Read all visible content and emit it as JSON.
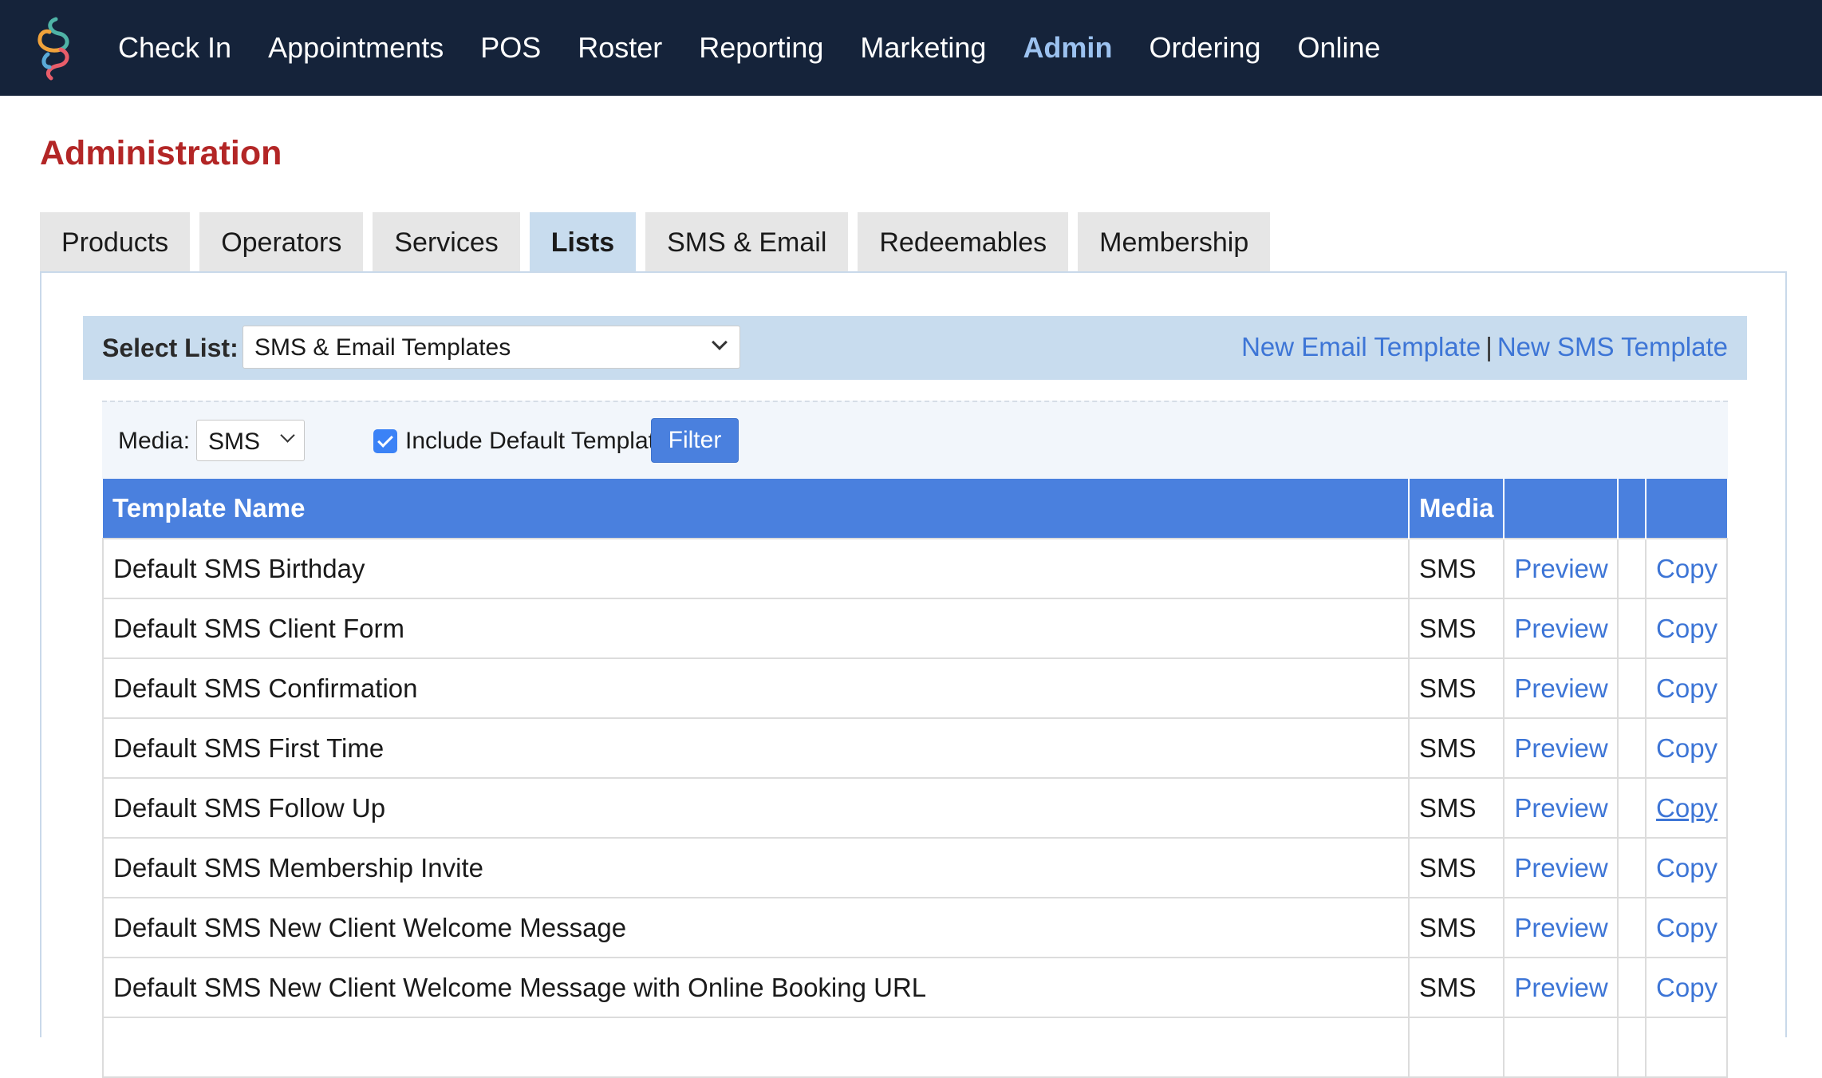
{
  "nav": {
    "items": [
      "Check In",
      "Appointments",
      "POS",
      "Roster",
      "Reporting",
      "Marketing",
      "Admin",
      "Ordering",
      "Online"
    ],
    "active": "Admin"
  },
  "page_title": "Administration",
  "tabs": {
    "items": [
      "Products",
      "Operators",
      "Services",
      "Lists",
      "SMS & Email",
      "Redeemables",
      "Membership"
    ],
    "active": "Lists"
  },
  "select_list": {
    "label": "Select List:",
    "value": "SMS & Email Templates"
  },
  "links": {
    "new_email": "New Email Template",
    "separator": "|",
    "new_sms": "New SMS Template"
  },
  "filter": {
    "media_label": "Media:",
    "media_value": "SMS",
    "include_default_label": "Include Default Templates",
    "include_default_checked": true,
    "button_label": "Filter"
  },
  "table": {
    "headers": [
      "Template Name",
      "Media",
      "",
      "",
      ""
    ],
    "rows": [
      {
        "name": "Default SMS Birthday",
        "media": "SMS",
        "preview": "Preview",
        "copy": "Copy"
      },
      {
        "name": "Default SMS Client Form",
        "media": "SMS",
        "preview": "Preview",
        "copy": "Copy"
      },
      {
        "name": "Default SMS Confirmation",
        "media": "SMS",
        "preview": "Preview",
        "copy": "Copy"
      },
      {
        "name": "Default SMS First Time",
        "media": "SMS",
        "preview": "Preview",
        "copy": "Copy"
      },
      {
        "name": "Default SMS Follow Up",
        "media": "SMS",
        "preview": "Preview",
        "copy": "Copy",
        "hovered": true
      },
      {
        "name": "Default SMS Membership Invite",
        "media": "SMS",
        "preview": "Preview",
        "copy": "Copy"
      },
      {
        "name": "Default SMS New Client Welcome Message",
        "media": "SMS",
        "preview": "Preview",
        "copy": "Copy"
      },
      {
        "name": "Default SMS New Client Welcome Message with Online Booking URL",
        "media": "SMS",
        "preview": "Preview",
        "copy": "Copy"
      },
      {
        "name": "",
        "media": "",
        "preview": "",
        "copy": ""
      }
    ]
  },
  "colors": {
    "nav_bg": "#15233a",
    "title_red": "#b32626",
    "header_blue": "#4a80de",
    "link_blue": "#3d75d6",
    "tab_active_bg": "#c8dcee"
  },
  "icons": {
    "logo": "swirl-logo-icon",
    "dropdown": "chevron-down-icon",
    "checkbox": "checkmark-icon"
  }
}
